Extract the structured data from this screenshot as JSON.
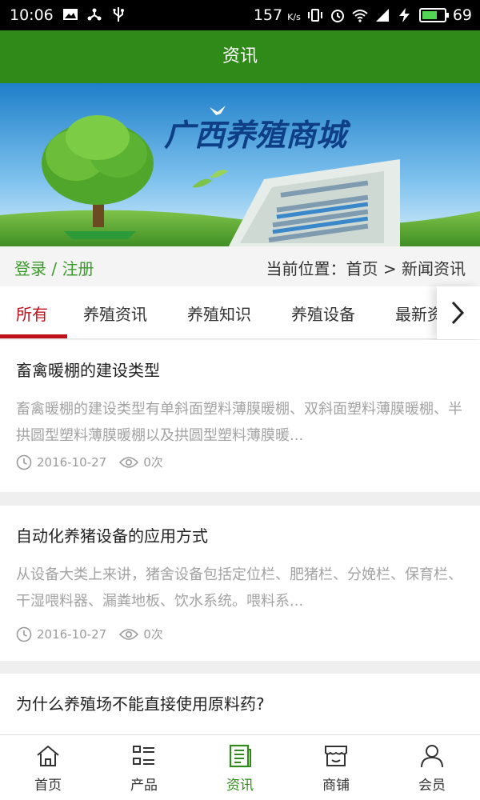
{
  "status_bar": {
    "time": "10:06",
    "network_speed": "157",
    "speed_unit": "K/s",
    "battery": "69",
    "battery_level": 0.69,
    "icons": [
      "image-icon",
      "usb-share-icon",
      "usb-icon",
      "vibrate-icon",
      "alarm-icon",
      "wifi-icon",
      "signal-4g-icon",
      "charging-icon",
      "battery-icon"
    ]
  },
  "header": {
    "title": "资讯"
  },
  "banner": {
    "headline": "广西养殖商城"
  },
  "location_bar": {
    "login_label": "登录 / 注册",
    "position_prefix": "当前位置：",
    "path": "首页 > 新闻资讯"
  },
  "tabs": [
    "所有",
    "养殖资讯",
    "养殖知识",
    "养殖设备",
    "最新资讯"
  ],
  "news": [
    {
      "title": "畜禽暖棚的建设类型",
      "summary": "畜禽暖棚的建设类型有单斜面塑料薄膜暖棚、双斜面塑料薄膜暖棚、半拱圆型塑料薄膜暖棚以及拱圆型塑料薄膜暖...",
      "date": "2016-10-27",
      "views": "0次"
    },
    {
      "title": "自动化养猪设备的应用方式",
      "summary": "从设备大类上来讲，猪舍设备包括定位栏、肥猪栏、分娩栏、保育栏、干湿喂料器、漏粪地板、饮水系统。喂料系...",
      "date": "2016-10-27",
      "views": "0次"
    },
    {
      "title": "为什么养殖场不能直接使用原料药?",
      "summary": "",
      "date": "",
      "views": ""
    }
  ],
  "bottom_nav": [
    {
      "label": "首页",
      "icon": "home-icon"
    },
    {
      "label": "产品",
      "icon": "product-list-icon"
    },
    {
      "label": "资讯",
      "icon": "news-icon",
      "active": true
    },
    {
      "label": "商铺",
      "icon": "shop-icon"
    },
    {
      "label": "会员",
      "icon": "member-icon"
    }
  ],
  "colors": {
    "header_green": "#2f8a1a",
    "active_tab_red": "#c0101a",
    "login_green": "#3b9b2a"
  }
}
